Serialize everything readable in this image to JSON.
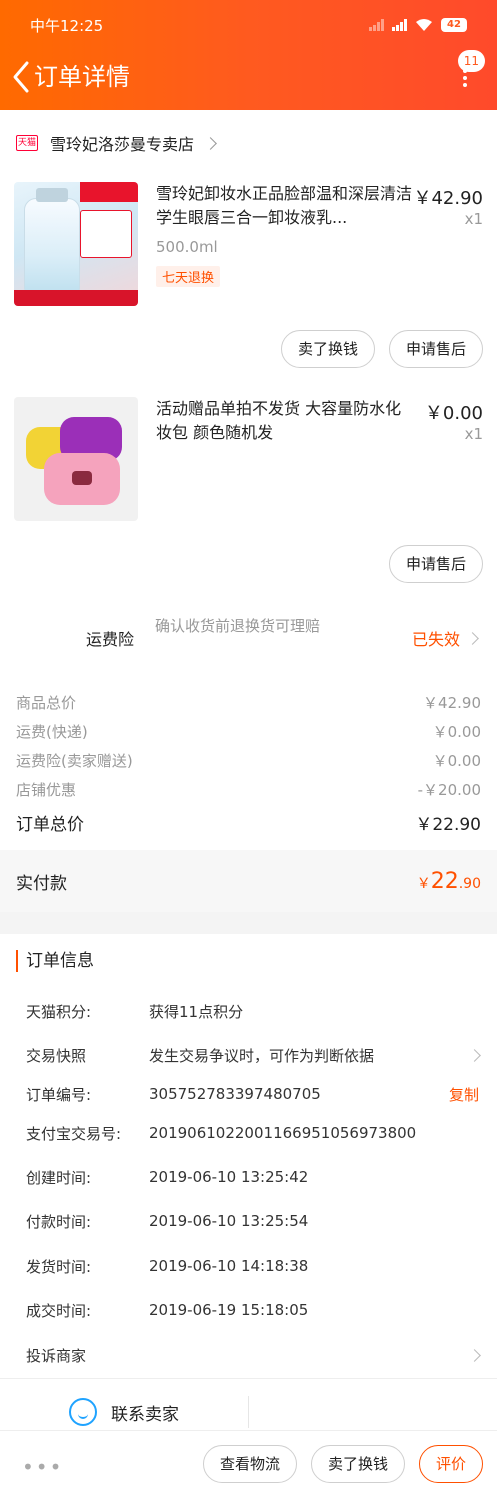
{
  "status_bar": {
    "time": "中午12:25",
    "battery": "42"
  },
  "nav": {
    "title": "订单详情",
    "badge": "11"
  },
  "store": {
    "tag": "天猫",
    "name": "雪玲妃洛莎曼专卖店"
  },
  "items": [
    {
      "title": "雪玲妃卸妆水正品脸部温和深层清洁学生眼唇三合一卸妆液乳...",
      "price": "￥42.90",
      "qty": "x1",
      "spec": "500.0ml",
      "tag": "七天退换",
      "buttons": [
        "卖了换钱",
        "申请售后"
      ]
    },
    {
      "title": "活动赠品单拍不发货  大容量防水化妆包 颜色随机发",
      "price": "￥0.00",
      "qty": "x1",
      "buttons": [
        "申请售后"
      ]
    }
  ],
  "insurance": {
    "label": "运费险",
    "desc": "确认收货前退换货可理赔",
    "status": "已失效"
  },
  "prices": [
    {
      "label": "商品总价",
      "value": "￥42.90"
    },
    {
      "label": "运费(快递)",
      "value": "￥0.00"
    },
    {
      "label": "运费险(卖家赠送)",
      "value": "￥0.00"
    },
    {
      "label": "店铺优惠",
      "value": "-￥20.00"
    }
  ],
  "order_total": {
    "label": "订单总价",
    "value": "￥22.90"
  },
  "paid": {
    "label": "实付款",
    "symbol": "￥",
    "int": "22",
    "dec": ".90"
  },
  "info": {
    "title": "订单信息",
    "rows": [
      {
        "key": "天猫积分:",
        "value": "获得11点积分"
      },
      {
        "key": "交易快照",
        "value": "发生交易争议时，可作为判断依据"
      },
      {
        "key": "订单编号:",
        "value": "305752783397480705",
        "action": "复制"
      },
      {
        "key": "支付宝交易号:",
        "value": "2019061022001166951056973800"
      },
      {
        "key": "创建时间:",
        "value": "2019-06-10 13:25:42"
      },
      {
        "key": "付款时间:",
        "value": "2019-06-10 13:25:54"
      },
      {
        "key": "发货时间:",
        "value": "2019-06-10 14:18:38"
      },
      {
        "key": "成交时间:",
        "value": "2019-06-19 15:18:05"
      }
    ],
    "complain": "投诉商家"
  },
  "contact": {
    "label": "联系卖家"
  },
  "bottom": {
    "more": "•••",
    "buttons": [
      "查看物流",
      "卖了换钱",
      "评价"
    ]
  },
  "colors": {
    "accent": "#ff5000",
    "header_from": "#ff6a00",
    "header_to": "#ff4a2b"
  }
}
